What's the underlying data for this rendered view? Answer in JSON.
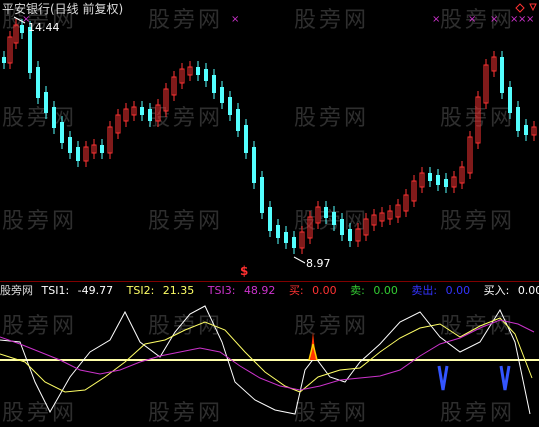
{
  "header": {
    "title": "平安银行(日线 前复权)"
  },
  "price_panel": {
    "high_label": "14.44",
    "low_label": "8.97",
    "signal_mark": "$",
    "colors": {
      "up": "#ff3333",
      "down": "#54ffff",
      "marker": "#cc33cc",
      "arrow": "#ff3333"
    }
  },
  "indicator": {
    "name": "股旁网",
    "tsi1_label": "TSI1:",
    "tsi1_value": "-49.77",
    "tsi2_label": "TSI2:",
    "tsi2_value": "21.35",
    "tsi3_label": "TSI3:",
    "tsi3_value": "48.92",
    "buy_label": "买:",
    "buy_value": "0.00",
    "sell_label": "卖:",
    "sell_value": "0.00",
    "sellout_label": "卖出:",
    "sellout_value": "0.00",
    "buyin_label": "买入:",
    "buyin_value": "0.00",
    "colors": {
      "tsi1": "#ffffff",
      "tsi2": "#ffff66",
      "tsi3": "#cc33cc",
      "buy": "#ff3333",
      "sell": "#33cc33",
      "sellout": "#3333ff",
      "buyin": "#ffffff",
      "baseline": "#ffffaa"
    }
  },
  "watermark": "股旁网"
}
